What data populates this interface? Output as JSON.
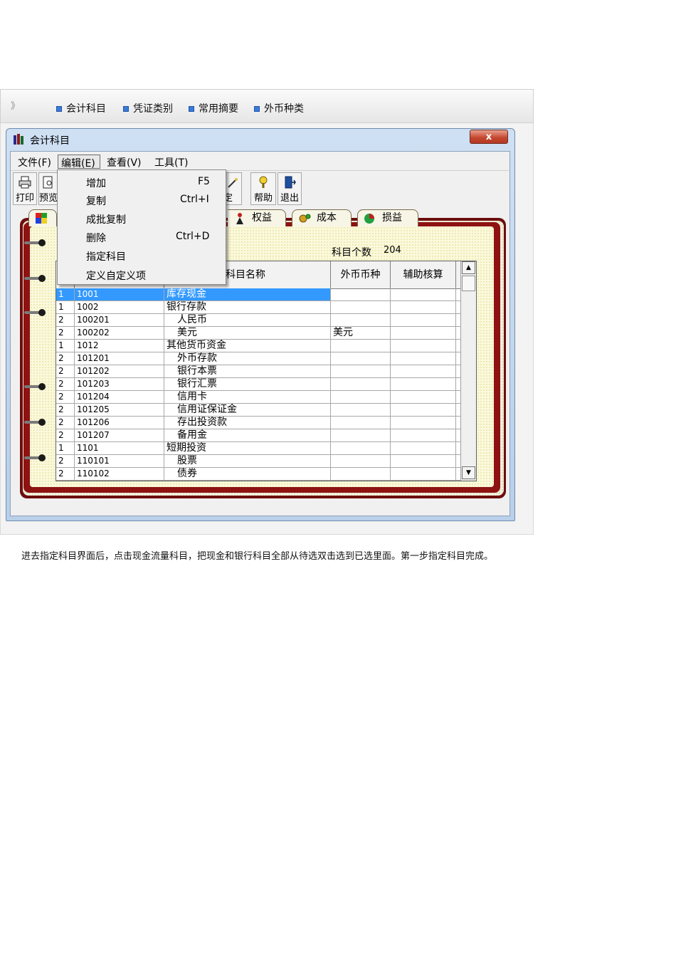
{
  "nav": {
    "chevron": "》",
    "links": [
      "会计科目",
      "凭证类别",
      "常用摘要",
      "外币种类"
    ]
  },
  "window": {
    "title": "会计科目",
    "close": "x"
  },
  "menubar": {
    "items": [
      "文件(F)",
      "编辑(E)",
      "查看(V)",
      "工具(T)"
    ]
  },
  "toolbar": {
    "print": "打印",
    "preview": "预览",
    "define_tail": "定义",
    "help": "帮助",
    "exit": "退出"
  },
  "tabs": {
    "equity": "权益",
    "cost": "成本",
    "profit_loss": "损益"
  },
  "summary": {
    "count_label": "科目个数",
    "count_value": "204"
  },
  "grid": {
    "headers": [
      "科目名称",
      "外币币种",
      "辅助核算"
    ],
    "rows": [
      {
        "level": "1",
        "code": "1001",
        "name": "库存现金",
        "currency": ""
      },
      {
        "level": "1",
        "code": "1002",
        "name": "银行存款",
        "currency": ""
      },
      {
        "level": "2",
        "code": "100201",
        "name": "人民币",
        "currency": ""
      },
      {
        "level": "2",
        "code": "100202",
        "name": "美元",
        "currency": "美元"
      },
      {
        "level": "1",
        "code": "1012",
        "name": "其他货币资金",
        "currency": ""
      },
      {
        "level": "2",
        "code": "101201",
        "name": "外币存款",
        "currency": ""
      },
      {
        "level": "2",
        "code": "101202",
        "name": "银行本票",
        "currency": ""
      },
      {
        "level": "2",
        "code": "101203",
        "name": "银行汇票",
        "currency": ""
      },
      {
        "level": "2",
        "code": "101204",
        "name": "信用卡",
        "currency": ""
      },
      {
        "level": "2",
        "code": "101205",
        "name": "信用证保证金",
        "currency": ""
      },
      {
        "level": "2",
        "code": "101206",
        "name": "存出投资款",
        "currency": ""
      },
      {
        "level": "2",
        "code": "101207",
        "name": "备用金",
        "currency": ""
      },
      {
        "level": "1",
        "code": "1101",
        "name": "短期投资",
        "currency": ""
      },
      {
        "level": "2",
        "code": "110101",
        "name": "股票",
        "currency": ""
      },
      {
        "level": "2",
        "code": "110102",
        "name": "债券",
        "currency": ""
      }
    ]
  },
  "edit_menu": {
    "items": [
      {
        "label": "增加",
        "shortcut": "F5"
      },
      {
        "label": "复制",
        "shortcut": "Ctrl+I"
      },
      {
        "label": "成批复制",
        "shortcut": ""
      },
      {
        "label": "删除",
        "shortcut": "Ctrl+D"
      },
      {
        "label": "指定科目",
        "shortcut": ""
      },
      {
        "label": "定义自定义项",
        "shortcut": ""
      }
    ]
  },
  "caption": "进去指定科目界面后，点击现金流量科目，把现金和银行科目全部从待选双击选到已选里面。第一步指定科目完成。",
  "colors": {
    "selection": "#3399ff",
    "notebook_red": "#8e1212",
    "page_yellow": "#fbf9dc",
    "close_red": "#c4452d"
  }
}
